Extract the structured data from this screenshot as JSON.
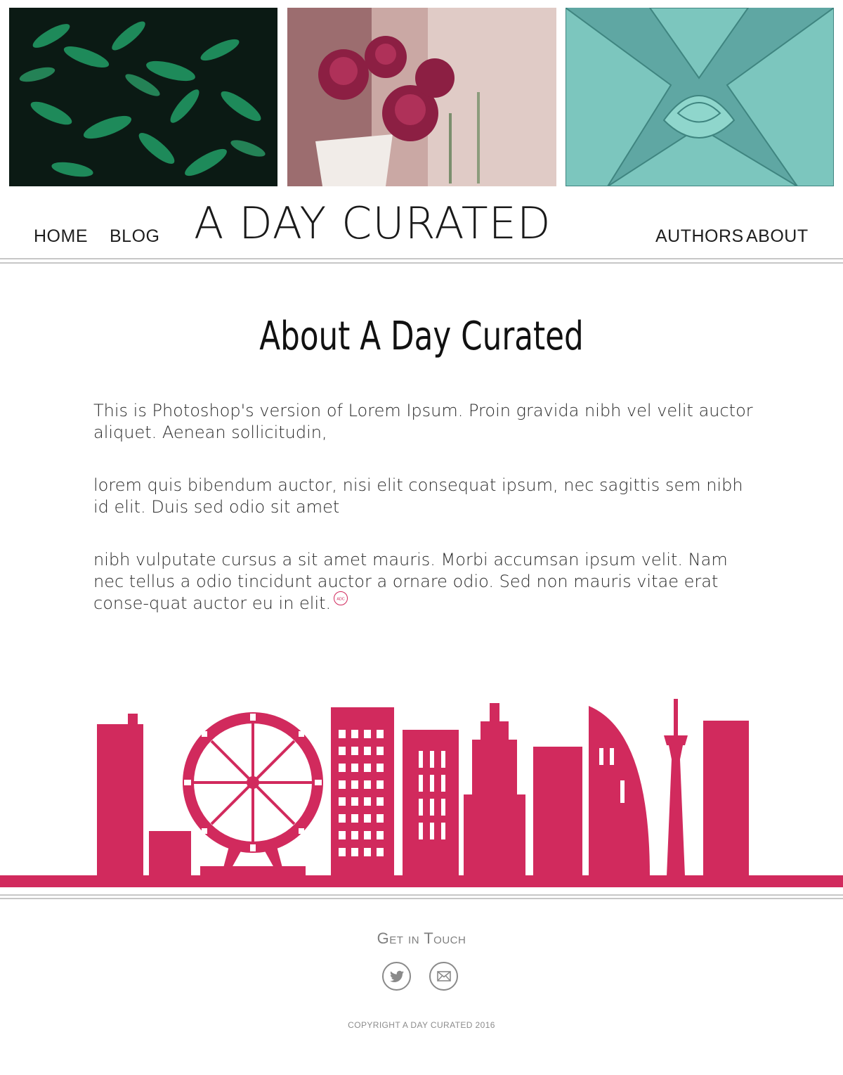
{
  "header": {
    "photos": [
      {
        "subject": "green fern leaves"
      },
      {
        "subject": "pink ranunculus flowers"
      },
      {
        "subject": "blue agave succulent"
      }
    ],
    "site_title": "A DAY CURATED",
    "nav": {
      "home": "HOME",
      "blog": "BLOG",
      "authors": "AUTHORS",
      "about": "ABOUT"
    }
  },
  "main": {
    "heading": "About A Day Curated",
    "paragraphs": [
      "This is Photoshop's version  of Lorem Ipsum. Proin gravida nibh vel velit auctor aliquet. Aenean sollicitudin,",
      "lorem quis bibendum auctor, nisi elit consequat ipsum, nec sagittis sem nibh id elit. Duis sed odio sit amet",
      "nibh vulputate cursus a sit amet mauris. Morbi accumsan ipsum velit. Nam nec tellus a odio tincidunt auctor a ornare odio. Sed non  mauris vitae erat conse-quat auctor eu in elit."
    ],
    "end_stamp": "ADC"
  },
  "footer": {
    "heading": "Get in Touch",
    "social": [
      {
        "icon": "twitter-icon"
      },
      {
        "icon": "email-icon"
      }
    ],
    "copyright": "COPYRIGHT A DAY CURATED 2016"
  },
  "colors": {
    "accent": "#d12a5d",
    "rule": "#c7c7c7",
    "footer_text": "#7f7f7f"
  }
}
